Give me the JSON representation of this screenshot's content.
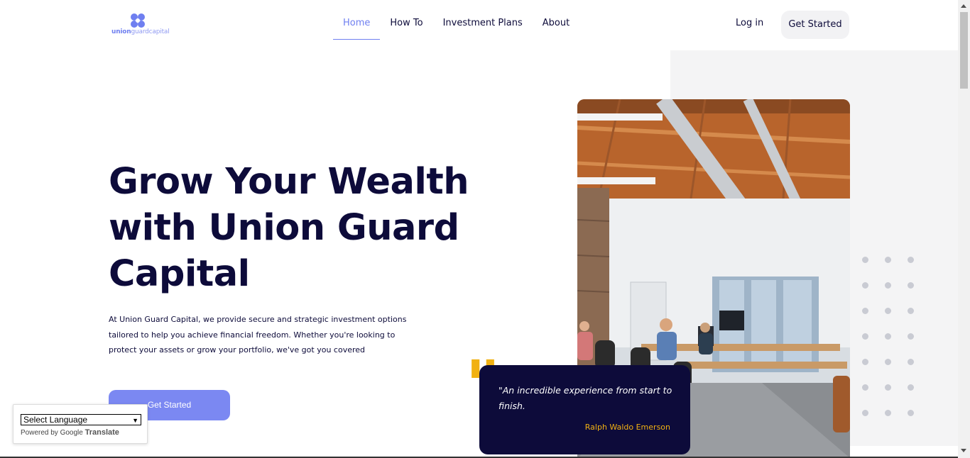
{
  "brand": {
    "logo_text_bold": "union",
    "logo_text_light": "guardcapital",
    "logo_icon": "clover-logo-icon"
  },
  "nav": {
    "items": [
      {
        "label": "Home",
        "active": true
      },
      {
        "label": "How To",
        "active": false
      },
      {
        "label": "Investment Plans",
        "active": false
      },
      {
        "label": "About",
        "active": false
      }
    ]
  },
  "header": {
    "login_label": "Log in",
    "get_started_label": "Get Started"
  },
  "hero": {
    "headline_line1": "Grow Your Wealth",
    "headline_line2": "with Union Guard",
    "headline_line3": "Capital",
    "description": "At Union Guard Capital, we provide secure and strategic investment options tailored to help you achieve financial freedom. Whether you're looking to protect your assets or grow your portfolio, we've got you covered",
    "cta_label": "Get Started"
  },
  "quote": {
    "mark": "\"",
    "text": "\"An incredible experience from start to finish.",
    "author": "Ralph Waldo Emerson"
  },
  "translate": {
    "select_value": "Select Language",
    "powered_by": "Powered by",
    "google": "Google",
    "translate_label": "Translate"
  },
  "colors": {
    "navy": "#0d0b3a",
    "accent": "#6f7ff0",
    "cta": "#7b88f2",
    "quote_accent": "#f1b112",
    "panel": "#f4f4f5"
  }
}
